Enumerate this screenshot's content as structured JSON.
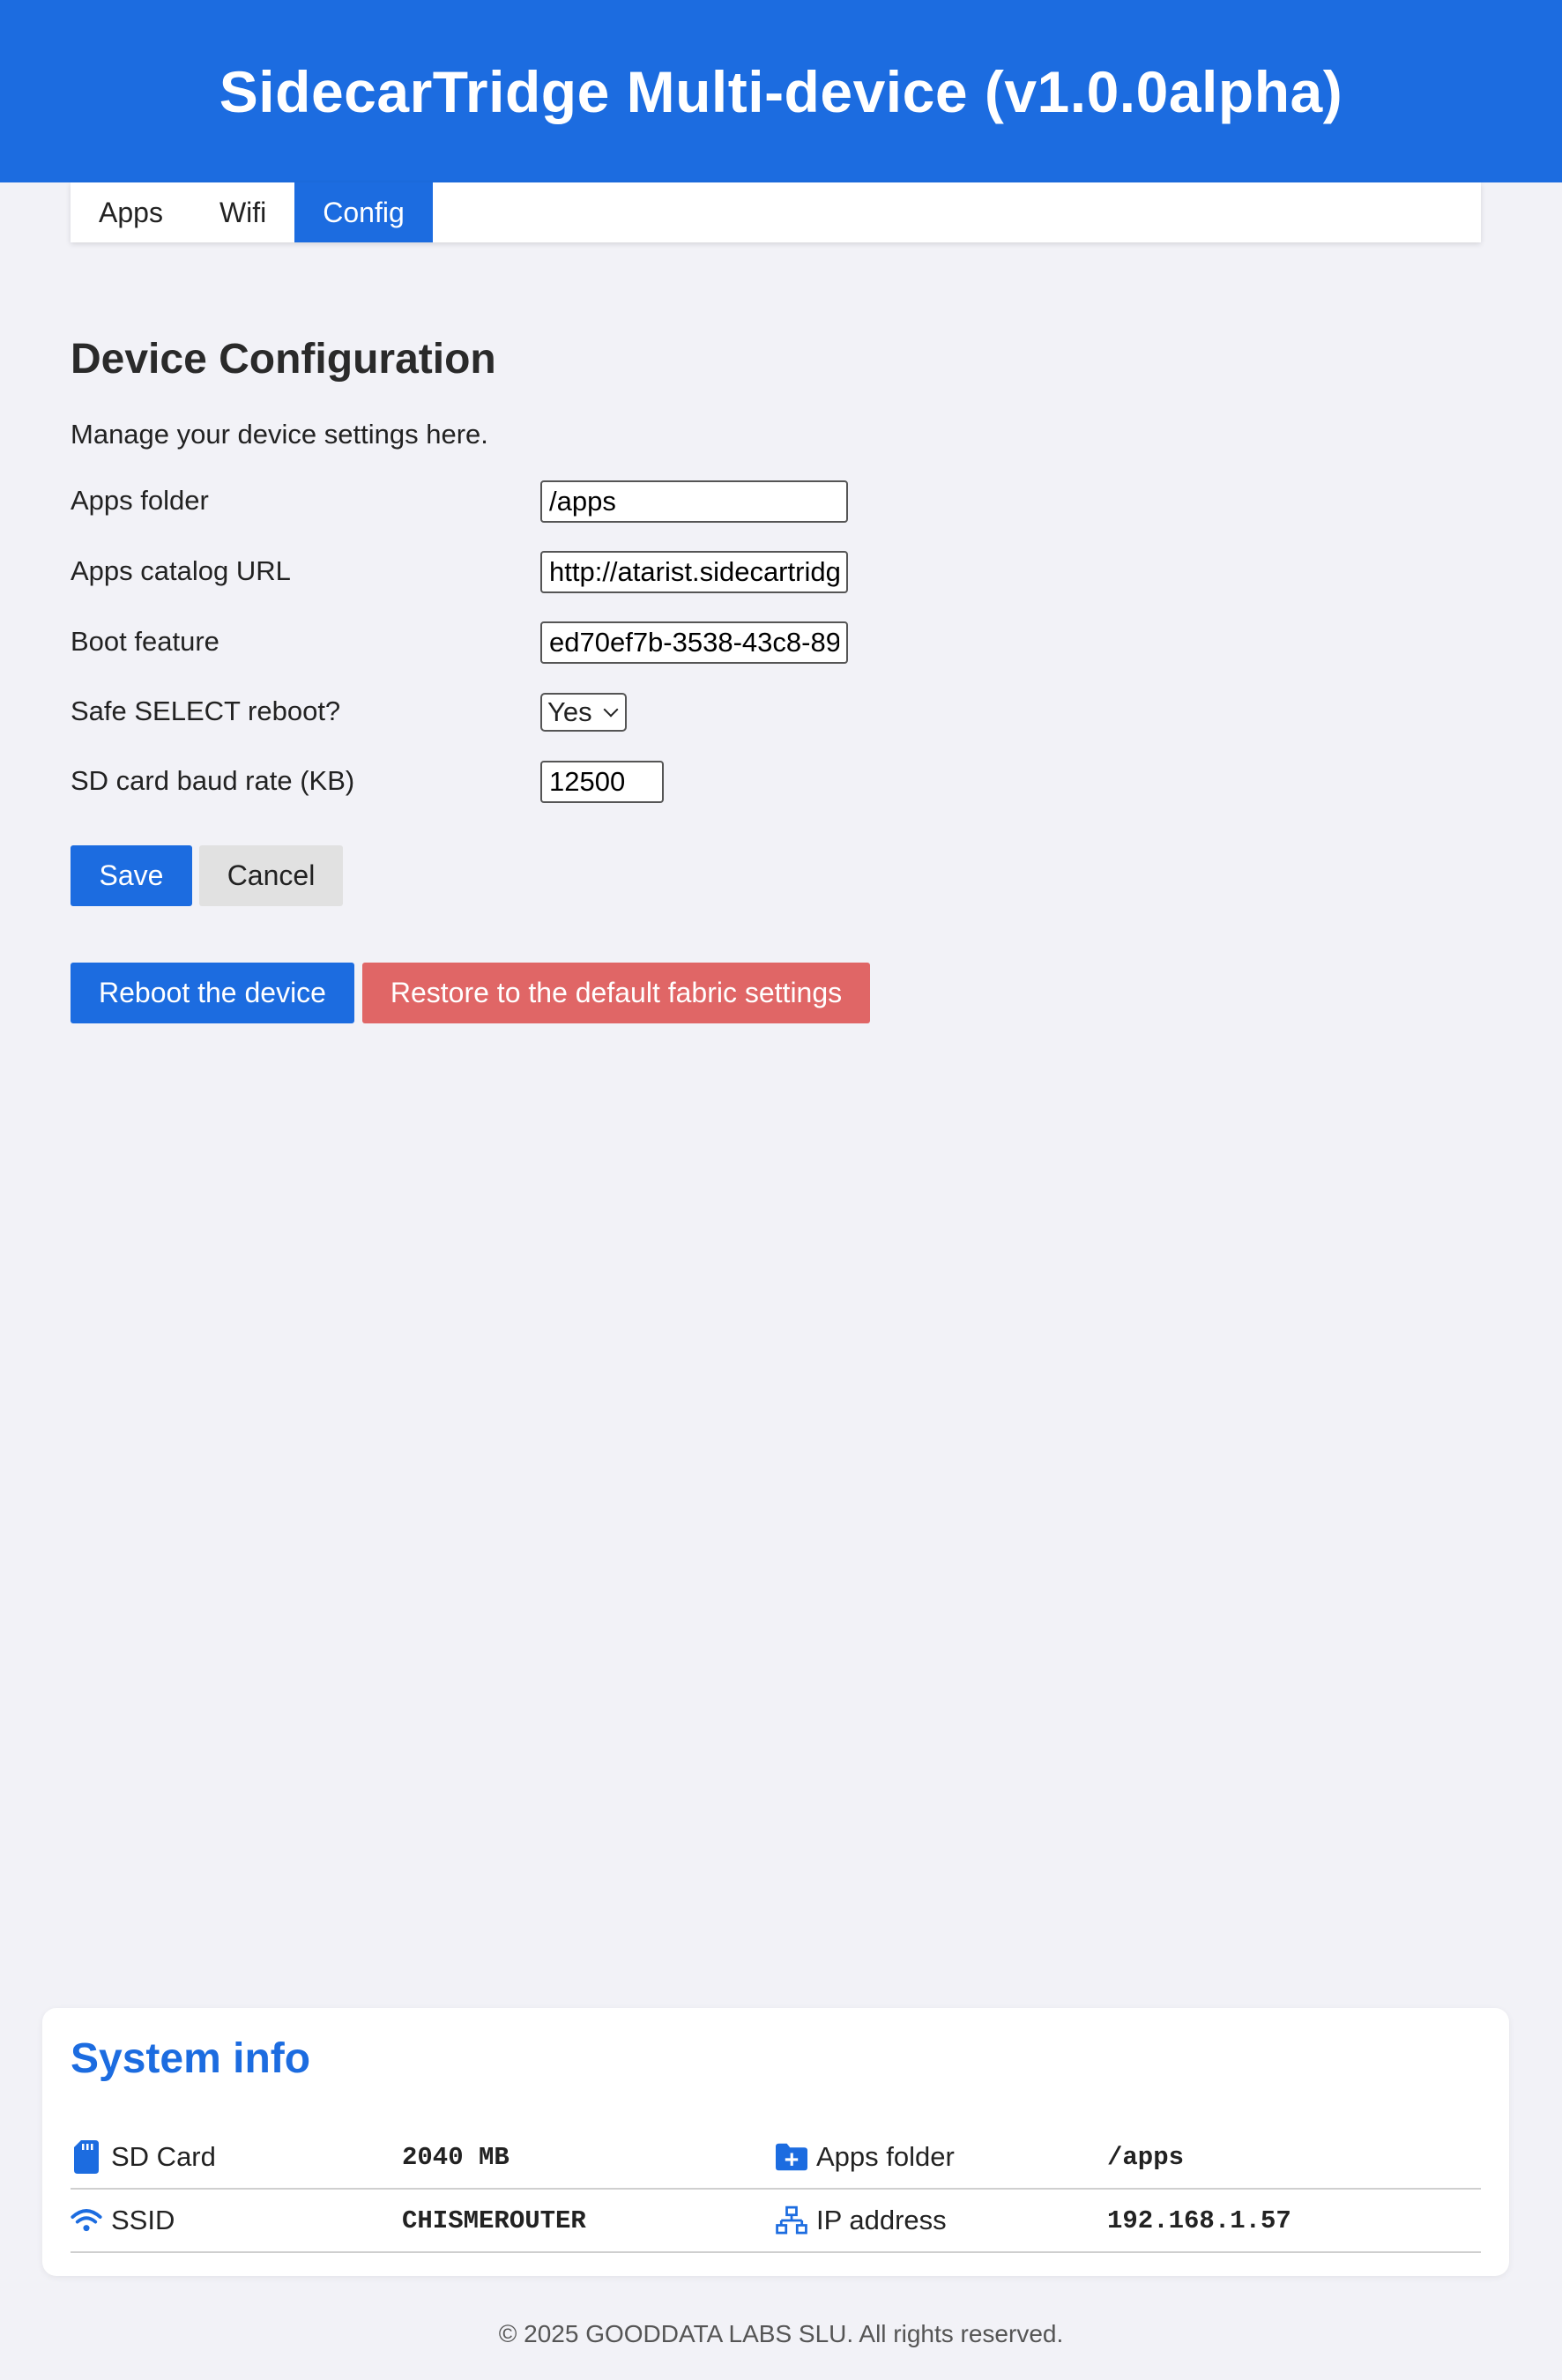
{
  "header": {
    "title": "SidecarTridge Multi-device (v1.0.0alpha)"
  },
  "tabs": [
    {
      "label": "Apps",
      "active": false
    },
    {
      "label": "Wifi",
      "active": false
    },
    {
      "label": "Config",
      "active": true
    }
  ],
  "config": {
    "title": "Device Configuration",
    "description": "Manage your device settings here.",
    "apps_folder": {
      "label": "Apps folder",
      "value": "/apps"
    },
    "apps_catalog_url": {
      "label": "Apps catalog URL",
      "value": "http://atarist.sidecartridge.com/apps.json"
    },
    "boot_feature": {
      "label": "Boot feature",
      "value": "ed70ef7b-3538-43c8-89"
    },
    "safe_select_reboot": {
      "label": "Safe SELECT reboot?",
      "value": "Yes"
    },
    "sd_baud_rate": {
      "label": "SD card baud rate (KB)",
      "value": "12500"
    },
    "save_label": "Save",
    "cancel_label": "Cancel",
    "reboot_label": "Reboot the device",
    "restore_label": "Restore to the default fabric settings"
  },
  "system_info": {
    "title": "System info",
    "sd_card": {
      "label": "SD Card",
      "value": "2040 MB"
    },
    "apps_folder": {
      "label": "Apps folder",
      "value": "/apps"
    },
    "ssid": {
      "label": "SSID",
      "value": "CHISMEROUTER"
    },
    "ip_address": {
      "label": "IP address",
      "value": "192.168.1.57"
    }
  },
  "footer": {
    "text": "© 2025 GOODDATA LABS SLU. All rights reserved."
  },
  "colors": {
    "primary": "#1c6ce0",
    "danger": "#e06666",
    "background": "#f2f2f7"
  },
  "icons": {
    "sd_card": "sd-card-icon",
    "apps_folder": "folder-plus-icon",
    "ssid": "wifi-icon",
    "ip_address": "network-icon"
  }
}
